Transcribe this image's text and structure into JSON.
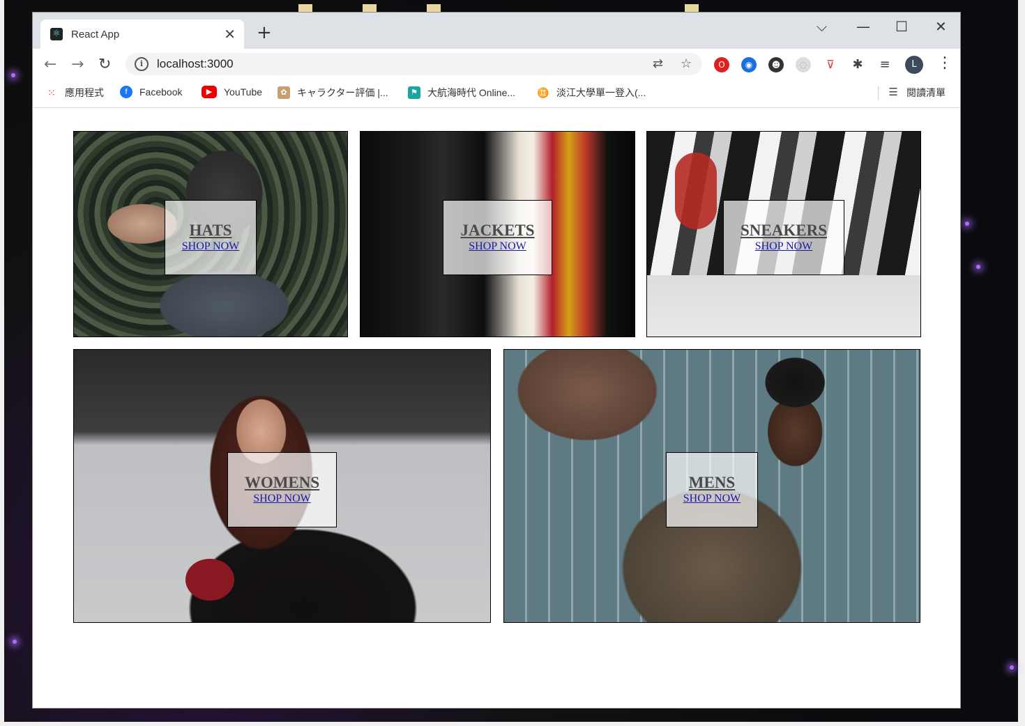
{
  "browser": {
    "tab_title": "React App",
    "url": "localhost:3000",
    "bookmarks": [
      {
        "label": "應用程式",
        "icon": "apps-grid-icon"
      },
      {
        "label": "Facebook",
        "icon": "facebook-icon"
      },
      {
        "label": "YouTube",
        "icon": "youtube-icon"
      },
      {
        "label": "キャラクター評価 |...",
        "icon": "character-site-icon"
      },
      {
        "label": "大航海時代 Online...",
        "icon": "game-site-icon"
      },
      {
        "label": "淡江大學單一登入(...",
        "icon": "university-icon"
      }
    ],
    "reading_list": "閱讀清單",
    "profile_initial": "L"
  },
  "directory": {
    "sections": [
      {
        "title": "HATS",
        "subtitle": "SHOP NOW"
      },
      {
        "title": "JACKETS",
        "subtitle": "SHOP NOW"
      },
      {
        "title": "SNEAKERS",
        "subtitle": "SHOP NOW"
      },
      {
        "title": "WOMENS",
        "subtitle": "SHOP NOW"
      },
      {
        "title": "MENS",
        "subtitle": "SHOP NOW"
      }
    ]
  },
  "colors": {
    "link": "#1a1aa6",
    "title": "#4a4a4a",
    "chrome_frame": "#dee1e6"
  }
}
